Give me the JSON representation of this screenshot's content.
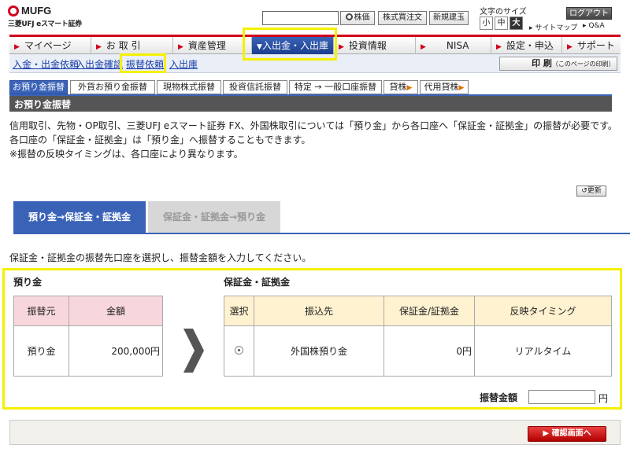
{
  "header": {
    "brand": "MUFG",
    "brand_sub": "三菱UFJ eスマート証券",
    "search_placeholder": "",
    "buttons": [
      "株価",
      "株式買注文",
      "新規建玉"
    ],
    "font_size_label": "文字のサイズ",
    "font_sizes": [
      "小",
      "中",
      "大"
    ],
    "logout": "ログアウト",
    "sitemap": "サイトマップ",
    "qa": "Q&A"
  },
  "nav": {
    "items": [
      "マイページ",
      "お 取 引",
      "資産管理",
      "入出金・入出庫",
      "投資情報",
      "NISA",
      "設定・申込",
      "サポート"
    ]
  },
  "subnav": {
    "links": [
      "入金・出金依頼",
      "入出金確認",
      "振替依頼",
      "入出庫"
    ],
    "print": "印 刷",
    "print_note": "（このページの印刷）"
  },
  "tabs": [
    "お預り金振替",
    "外貨お預り金振替",
    "現物株式振替",
    "投資信託振替",
    "特定 → 一般口座振替",
    "貸株",
    "代用貸株"
  ],
  "page_title": "お預り金振替",
  "description": [
    "信用取引、先物・OP取引、三菱UFJ eスマート証券 FX、外国株取引については「預り金」から各口座へ「保証金・証拠金」の振替が必要です。",
    "各口座の「保証金・証拠金」は「預り金」へ振替することもできます。",
    "※振替の反映タイミングは、各口座により異なります。"
  ],
  "refresh": "更新",
  "panel_tabs": [
    "預り金→保証金・証拠金",
    "保証金・証拠金→預り金"
  ],
  "instruction": "保証金・証拠金の振替先口座を選択し、振替金額を入力してください。",
  "source": {
    "label": "預り金",
    "headers": [
      "振替元",
      "金額"
    ],
    "row": {
      "name": "預り金",
      "amount": "200,000円"
    }
  },
  "destination": {
    "label": "保証金・証拠金",
    "headers": [
      "選択",
      "振込先",
      "保証金/証拠金",
      "反映タイミング"
    ],
    "row": {
      "name": "外国株預り金",
      "amount": "0円",
      "timing": "リアルタイム"
    }
  },
  "amount": {
    "label": "振替金額",
    "value": "",
    "unit": "円"
  },
  "confirm": "確認画面へ"
}
